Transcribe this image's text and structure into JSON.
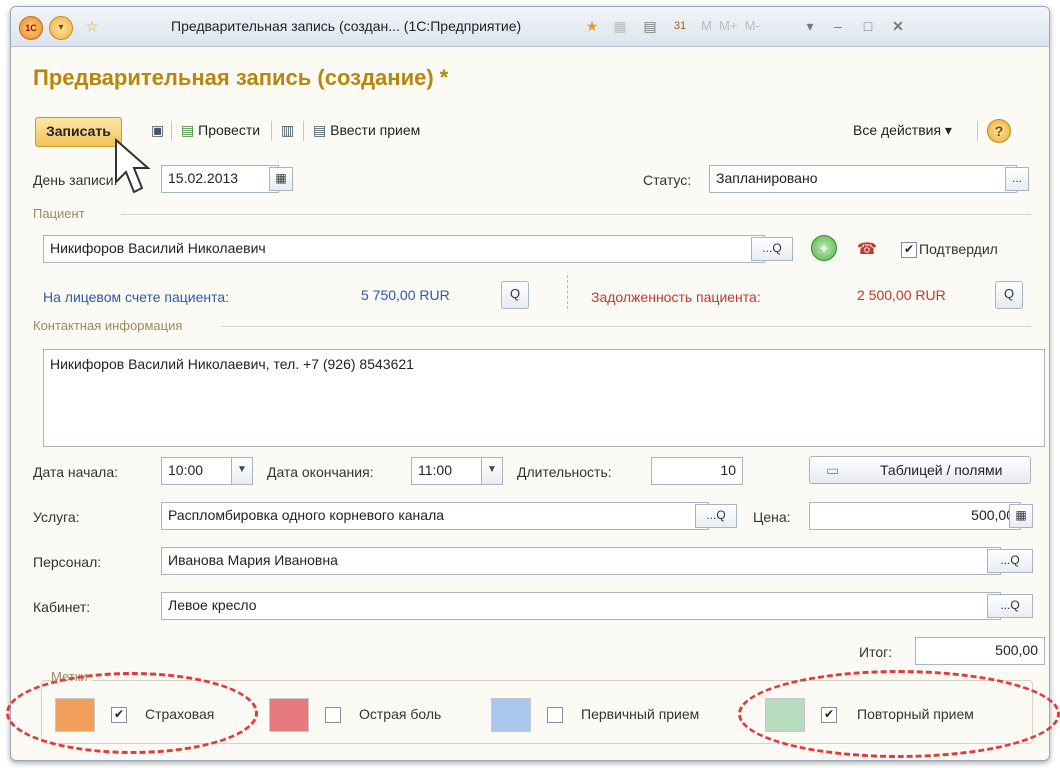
{
  "window": {
    "title": "Предварительная запись (создан... (1С:Предприятие)",
    "icons": [
      "1c-logo-icon",
      "menu-icon",
      "star-icon",
      "favorite-icon",
      "link-icon",
      "calculator-icon",
      "calendar-icon",
      "memory-icon",
      "minimize-icon",
      "restore-icon",
      "close-icon"
    ],
    "mem_labels": [
      "M",
      "M+",
      "M-"
    ]
  },
  "document": {
    "title": "Предварительная запись (создание) *"
  },
  "toolbar": {
    "save_label": "Записать",
    "post_label": "Провести",
    "enter_label": "Ввести прием",
    "all_actions_label": "Все действия ▾",
    "help_label": "?"
  },
  "form": {
    "record_day_label": "День записи:",
    "record_day_value": "15.02.2013",
    "status_label": "Статус:",
    "status_value": "Запланировано",
    "patient_group_title": "Пациент",
    "patient_value": "Никифоров Василий Николаевич",
    "confirmed_label": "Подтвердил",
    "balance_label": "На лицевом счете пациента:",
    "balance_value": "5 750,00 RUR",
    "debt_label": "Задолженность пациента:",
    "debt_value": "2 500,00 RUR",
    "contact_group_title": "Контактная информация",
    "contact_value": "Никифоров Василий Николаевич, тел. +7 (926) 8543621",
    "start_label": "Дата начала:",
    "start_value": "10:00",
    "end_label": "Дата окончания:",
    "end_value": "11:00",
    "duration_label": "Длительность:",
    "duration_value": "10",
    "table_fields_button": "Таблицей / полями",
    "service_label": "Услуга:",
    "service_value": "Распломбировка одного корневого канала",
    "price_label": "Цена:",
    "price_value": "500,00",
    "staff_label": "Персонал:",
    "staff_value": "Иванова Мария Ивановна",
    "cabinet_label": "Кабинет:",
    "cabinet_value": "Левое кресло",
    "total_label": "Итог:",
    "total_value": "500,00",
    "ellipsis": "...",
    "search_glyph": "Q"
  },
  "marks": {
    "group_title": "Метки",
    "items": [
      {
        "label": "Страховая",
        "checked": true,
        "color": "#f0a05a"
      },
      {
        "label": "Острая боль",
        "checked": false,
        "color": "#e77a7d"
      },
      {
        "label": "Первичный прием",
        "checked": false,
        "color": "#a9c8ee"
      },
      {
        "label": "Повторный прием",
        "checked": true,
        "color": "#b9dbbf"
      }
    ]
  },
  "colors": {
    "title_gold": "#b8860b",
    "link_blue": "#2b5bab",
    "debt_red": "#c0392b",
    "highlight_red": "#e23b3b"
  }
}
